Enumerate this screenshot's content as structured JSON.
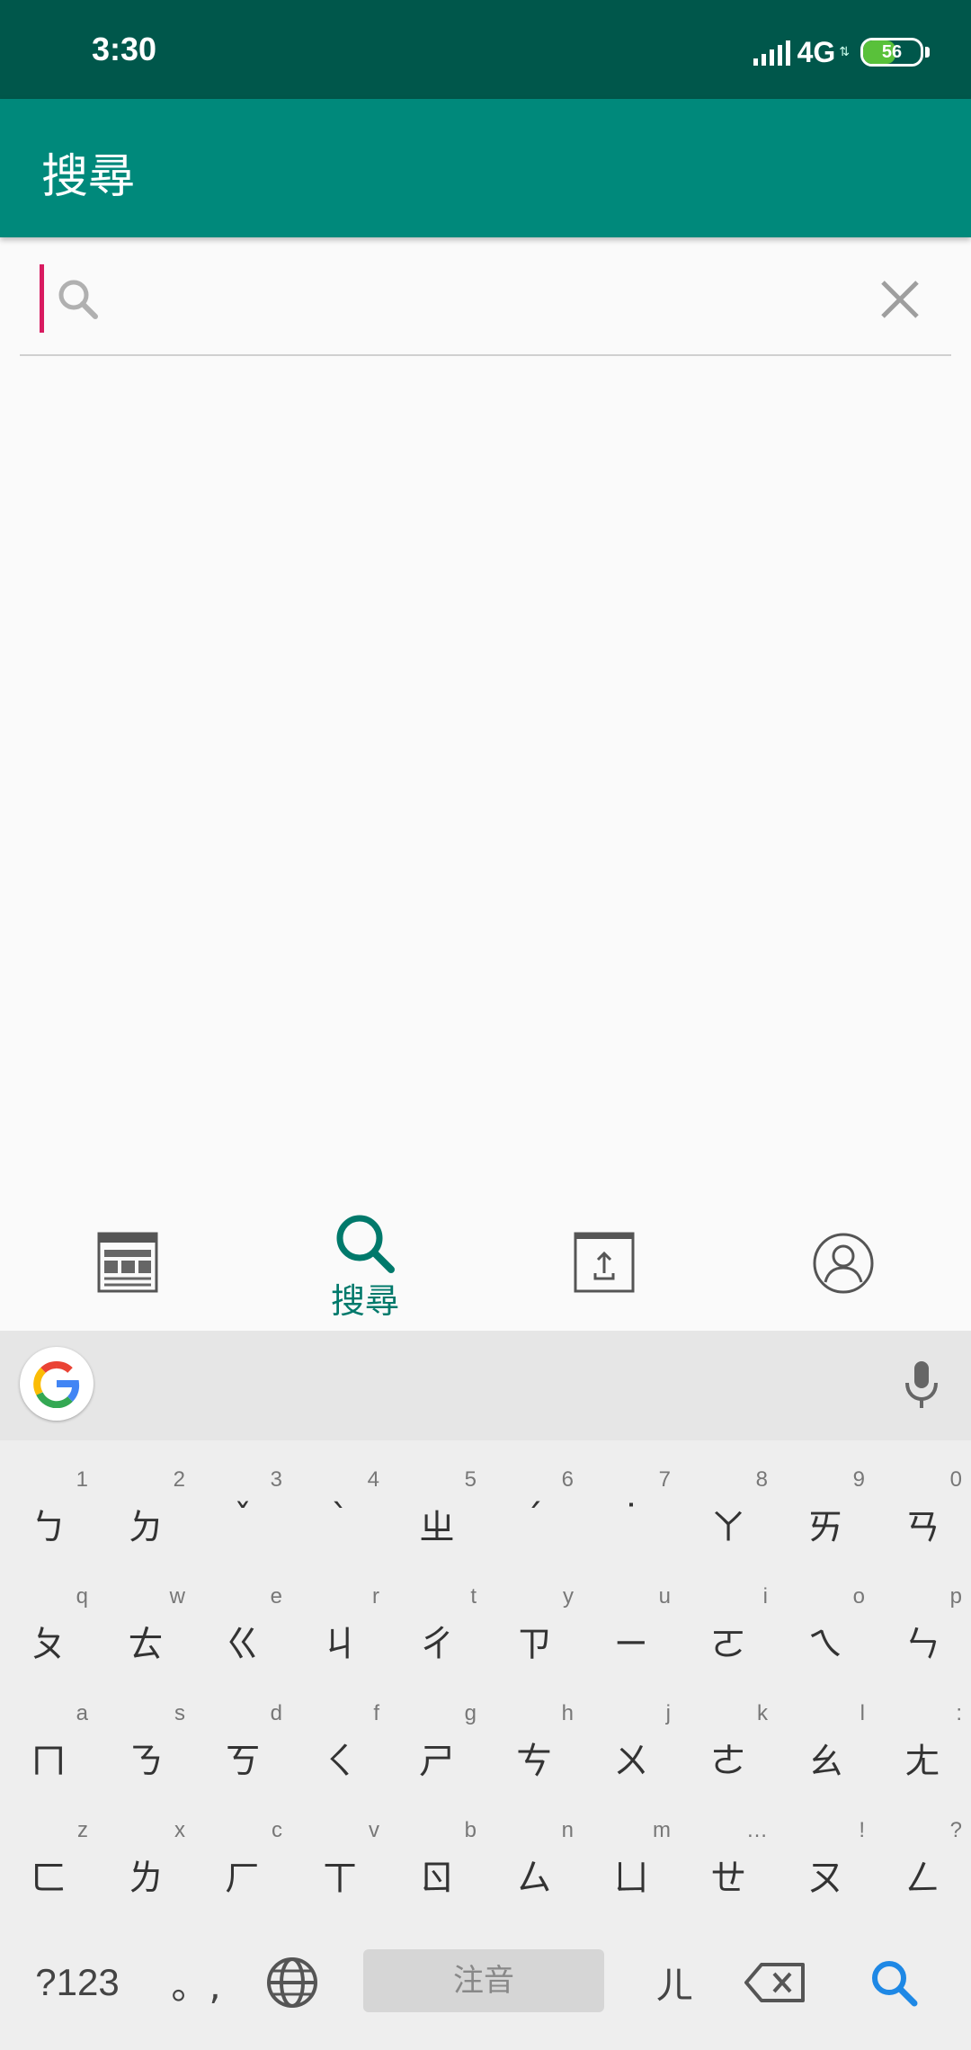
{
  "status_bar": {
    "time": "3:30",
    "network": "4G",
    "battery": "56",
    "battery_level": 0.56
  },
  "app_bar": {
    "title": "搜尋"
  },
  "search": {
    "placeholder": "",
    "value": ""
  },
  "bottom_nav": {
    "items": [
      {
        "icon": "table-icon",
        "label": ""
      },
      {
        "icon": "search-icon",
        "label": "搜尋",
        "active": true
      },
      {
        "icon": "upload-icon",
        "label": ""
      },
      {
        "icon": "account-icon",
        "label": ""
      }
    ]
  },
  "keyboard": {
    "row1": [
      {
        "hint": "1",
        "main": "ㄅ"
      },
      {
        "hint": "2",
        "main": "ㄉ"
      },
      {
        "hint": "3",
        "main": "ˇ"
      },
      {
        "hint": "4",
        "main": "ˋ"
      },
      {
        "hint": "5",
        "main": "ㄓ"
      },
      {
        "hint": "6",
        "main": "ˊ"
      },
      {
        "hint": "7",
        "main": "˙"
      },
      {
        "hint": "8",
        "main": "ㄚ"
      },
      {
        "hint": "9",
        "main": "ㄞ"
      },
      {
        "hint": "0",
        "main": "ㄢ"
      }
    ],
    "row2": [
      {
        "hint": "q",
        "main": "ㄆ"
      },
      {
        "hint": "w",
        "main": "ㄊ"
      },
      {
        "hint": "e",
        "main": "ㄍ"
      },
      {
        "hint": "r",
        "main": "ㄐ"
      },
      {
        "hint": "t",
        "main": "ㄔ"
      },
      {
        "hint": "y",
        "main": "ㄗ"
      },
      {
        "hint": "u",
        "main": "ㄧ"
      },
      {
        "hint": "i",
        "main": "ㄛ"
      },
      {
        "hint": "o",
        "main": "ㄟ"
      },
      {
        "hint": "p",
        "main": "ㄣ"
      }
    ],
    "row3": [
      {
        "hint": "a",
        "main": "ㄇ"
      },
      {
        "hint": "s",
        "main": "ㄋ"
      },
      {
        "hint": "d",
        "main": "ㄎ"
      },
      {
        "hint": "f",
        "main": "ㄑ"
      },
      {
        "hint": "g",
        "main": "ㄕ"
      },
      {
        "hint": "h",
        "main": "ㄘ"
      },
      {
        "hint": "j",
        "main": "ㄨ"
      },
      {
        "hint": "k",
        "main": "ㄜ"
      },
      {
        "hint": "l",
        "main": "ㄠ"
      },
      {
        "hint": ":",
        "main": "ㄤ"
      }
    ],
    "row4": [
      {
        "hint": "z",
        "main": "ㄈ"
      },
      {
        "hint": "x",
        "main": "ㄌ"
      },
      {
        "hint": "c",
        "main": "ㄏ"
      },
      {
        "hint": "v",
        "main": "ㄒ"
      },
      {
        "hint": "b",
        "main": "ㄖ"
      },
      {
        "hint": "n",
        "main": "ㄙ"
      },
      {
        "hint": "m",
        "main": "ㄩ"
      },
      {
        "hint": "…",
        "main": "ㄝ"
      },
      {
        "hint": "!",
        "main": "ㄡ"
      },
      {
        "hint": "?",
        "main": "ㄥ"
      }
    ],
    "symbols_label": "?123",
    "punct_label": "。,",
    "space_label": "注音",
    "er_label": "ㄦ",
    "accent_color": "#1e88e5"
  },
  "colors": {
    "status_bar": "#00574b",
    "app_bar": "#00897b",
    "accent": "#00796b",
    "cursor": "#d81b60"
  }
}
